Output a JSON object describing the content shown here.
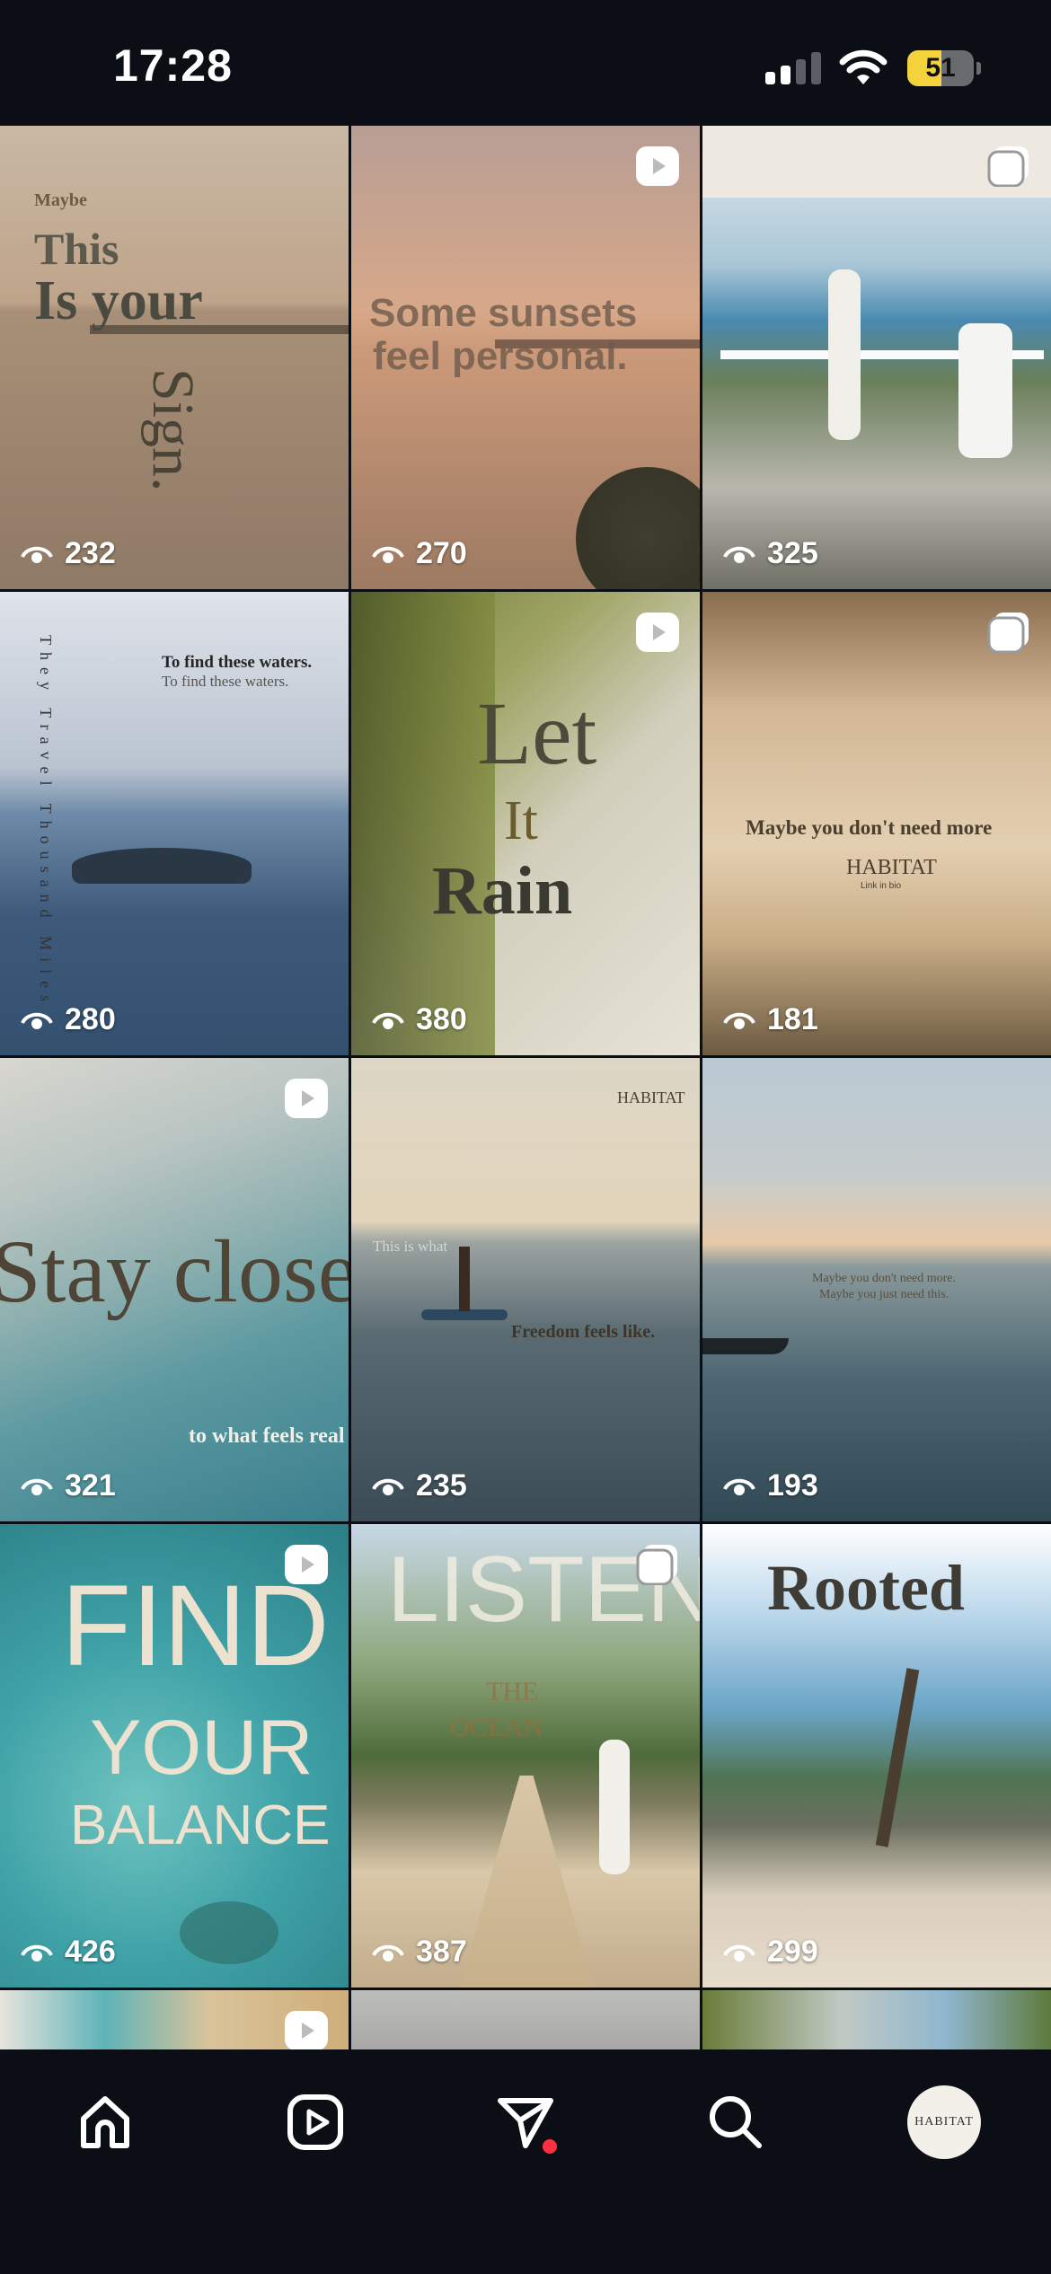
{
  "status_bar": {
    "time": "17:28",
    "battery_level": "51",
    "battery_fraction": 0.51,
    "signal_bars_active": 2,
    "signal_bars_total": 4
  },
  "icons": {
    "views": "eye-icon",
    "reel_badge": "play-square-icon",
    "carousel_badge": "stack-icon"
  },
  "posts": [
    {
      "views": "232",
      "badge": "none",
      "captions": [
        "Maybe",
        "This",
        "Is your",
        "Sign."
      ]
    },
    {
      "views": "270",
      "badge": "reel",
      "captions": [
        "Some sunsets",
        "feel personal."
      ]
    },
    {
      "views": "325",
      "badge": "carousel",
      "captions": []
    },
    {
      "views": "280",
      "badge": "none",
      "captions": [
        "They Travel Thousand Miles",
        "To find these waters.",
        "To find these waters."
      ]
    },
    {
      "views": "380",
      "badge": "reel",
      "captions": [
        "Let",
        "It",
        "Rain"
      ]
    },
    {
      "views": "181",
      "badge": "carousel",
      "captions": [
        "Maybe you don't need more",
        "HABITAT",
        "Link in bio"
      ]
    },
    {
      "views": "321",
      "badge": "reel",
      "captions": [
        "Stay close",
        "to what feels real"
      ]
    },
    {
      "views": "235",
      "badge": "none",
      "captions": [
        "HABITAT",
        "This is what",
        "Freedom feels like."
      ]
    },
    {
      "views": "193",
      "badge": "none",
      "captions": [
        "Maybe you don't need more.",
        "Maybe you just need this."
      ]
    },
    {
      "views": "426",
      "badge": "reel",
      "captions": [
        "FIND",
        "YOUR",
        "BALANCE"
      ]
    },
    {
      "views": "387",
      "badge": "carousel",
      "captions": [
        "LISTEN",
        "THE",
        "OCEAN"
      ]
    },
    {
      "views": "299",
      "badge": "none",
      "captions": [
        "Rooted"
      ]
    }
  ],
  "nav": {
    "items": [
      "home",
      "reels",
      "messages",
      "search",
      "profile"
    ],
    "profile_avatar_text": "HABITAT",
    "colors": {
      "notification": "#ff3040"
    }
  }
}
